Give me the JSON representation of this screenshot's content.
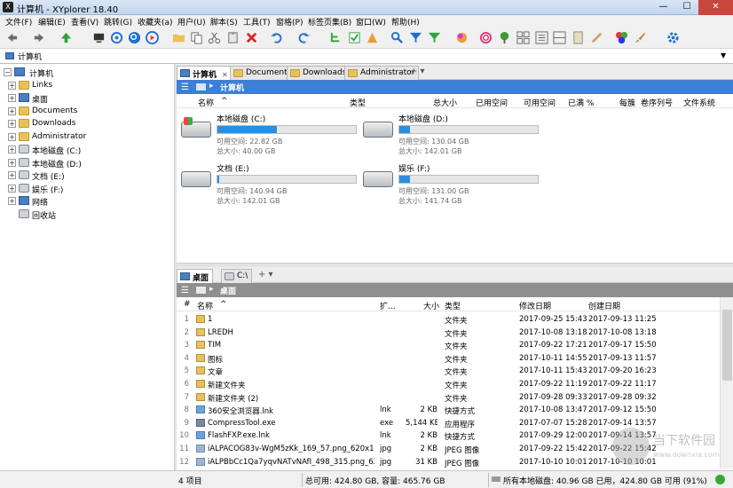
{
  "window": {
    "title": "计算机 - XYplorer 18.40",
    "min": "—",
    "max": "☐",
    "close": "✕",
    "app_icon": "X"
  },
  "menu": [
    "文件(F)",
    "编辑(E)",
    "查看(V)",
    "跳转(G)",
    "收藏夹(a)",
    "用户(U)",
    "脚本(S)",
    "工具(T)",
    "窗格(P)",
    "标签页集(B)",
    "窗口(W)",
    "帮助(H)"
  ],
  "address": {
    "value": "计算机"
  },
  "tree": [
    {
      "label": "计算机",
      "level": 0,
      "icon": "computer-icon",
      "expander": "−"
    },
    {
      "label": "Links",
      "level": 1,
      "icon": "folder-icon",
      "expander": "+"
    },
    {
      "label": "桌面",
      "level": 1,
      "icon": "desktop-icon",
      "expander": "+"
    },
    {
      "label": "Documents",
      "level": 1,
      "icon": "folder-icon",
      "expander": "+"
    },
    {
      "label": "Downloads",
      "level": 1,
      "icon": "folder-icon",
      "expander": "+"
    },
    {
      "label": "Administrator",
      "level": 1,
      "icon": "folder-icon",
      "expander": "+"
    },
    {
      "label": "本地磁盘 (C:)",
      "level": 1,
      "icon": "drive-icon",
      "expander": "+"
    },
    {
      "label": "本地磁盘 (D:)",
      "level": 1,
      "icon": "drive-icon",
      "expander": "+"
    },
    {
      "label": "文档 (E:)",
      "level": 1,
      "icon": "drive-icon",
      "expander": "+"
    },
    {
      "label": "娱乐 (F:)",
      "level": 1,
      "icon": "drive-icon",
      "expander": "+"
    },
    {
      "label": "网络",
      "level": 1,
      "icon": "network-icon",
      "expander": "+"
    },
    {
      "label": "回收站",
      "level": 1,
      "icon": "recycle-bin-icon",
      "expander": ""
    }
  ],
  "top_pane": {
    "tabs": [
      {
        "label": "计算机",
        "active": true,
        "close": "✕"
      },
      {
        "label": "Documents",
        "active": false
      },
      {
        "label": "Downloads",
        "active": false
      },
      {
        "label": "Administrator",
        "active": false
      }
    ],
    "tab_add": "+ ▾",
    "breadcrumb": "计算机",
    "columns": [
      "名称",
      "^",
      "类型",
      "总大小",
      "已用空间",
      "可用空间",
      "已满 %",
      "每簇",
      "卷序列号",
      "文件系统"
    ],
    "drives": [
      {
        "name": "本地磁盘 (C:)",
        "free": "可用空间: 22.82 GB",
        "total": "总大小: 40.00 GB",
        "used_fraction": 0.43,
        "system": true
      },
      {
        "name": "本地磁盘 (D:)",
        "free": "可用空间: 130.04 GB",
        "total": "总大小: 142.01 GB",
        "used_fraction": 0.08,
        "system": false
      },
      {
        "name": "文档 (E:)",
        "free": "可用空间: 140.94 GB",
        "total": "总大小: 142.01 GB",
        "used_fraction": 0.01,
        "system": false
      },
      {
        "name": "娱乐 (F:)",
        "free": "可用空间: 131.00 GB",
        "total": "总大小: 141.74 GB",
        "used_fraction": 0.08,
        "system": false
      }
    ]
  },
  "bottom_pane": {
    "tabs": [
      {
        "label": "桌面",
        "active": true
      },
      {
        "label": "C:\\",
        "active": false
      }
    ],
    "tab_add": "+ ▾",
    "breadcrumb": "桌面",
    "columns": [
      "#",
      "名称",
      "^",
      "扩...",
      "大小",
      "类型",
      "修改日期",
      "创建日期"
    ],
    "files": [
      {
        "n": "1",
        "name": "1",
        "ext": "",
        "size": "",
        "type": "文件夹",
        "modified": "2017-09-25 15:43:42",
        "created": "2017-09-13 11:25:34",
        "icon": "folder-icon"
      },
      {
        "n": "2",
        "name": "LREDH",
        "ext": "",
        "size": "",
        "type": "文件夹",
        "modified": "2017-10-08 13:18:07",
        "created": "2017-10-08 13:18:07",
        "icon": "folder-icon"
      },
      {
        "n": "3",
        "name": "TIM",
        "ext": "",
        "size": "",
        "type": "文件夹",
        "modified": "2017-09-22 17:21:04",
        "created": "2017-09-17 15:50:34",
        "icon": "folder-icon"
      },
      {
        "n": "4",
        "name": "图标",
        "ext": "",
        "size": "",
        "type": "文件夹",
        "modified": "2017-10-11 14:55:20",
        "created": "2017-09-13 11:57:22",
        "icon": "folder-icon"
      },
      {
        "n": "5",
        "name": "文章",
        "ext": "",
        "size": "",
        "type": "文件夹",
        "modified": "2017-10-11 15:43:10",
        "created": "2017-09-20 16:23:02",
        "icon": "folder-icon"
      },
      {
        "n": "6",
        "name": "新建文件夹",
        "ext": "",
        "size": "",
        "type": "文件夹",
        "modified": "2017-09-22 11:19:18",
        "created": "2017-09-22 11:17:16",
        "icon": "folder-icon"
      },
      {
        "n": "7",
        "name": "新建文件夹 (2)",
        "ext": "",
        "size": "",
        "type": "文件夹",
        "modified": "2017-09-28 09:33:34",
        "created": "2017-09-28 09:32:50",
        "icon": "folder-icon"
      },
      {
        "n": "8",
        "name": "360安全浏览器.lnk",
        "ext": "lnk",
        "size": "2 KB",
        "type": "快捷方式",
        "modified": "2017-10-08 13:47:28",
        "created": "2017-09-12 15:50:51",
        "icon": "shortcut-icon"
      },
      {
        "n": "9",
        "name": "CompressTool.exe",
        "ext": "exe",
        "size": "5,144 KB",
        "type": "应用程序",
        "modified": "2017-07-07 15:28:02",
        "created": "2017-09-14 13:57:56",
        "icon": "exe-icon"
      },
      {
        "n": "10",
        "name": "FlashFXP.exe.lnk",
        "ext": "lnk",
        "size": "2 KB",
        "type": "快捷方式",
        "modified": "2017-09-29 12:00:21",
        "created": "2017-09-14 13:57:38",
        "icon": "shortcut-icon"
      },
      {
        "n": "11",
        "name": "iALPACOG83v-WgM5zKk_169_57.png_620x10000...",
        "ext": "jpg",
        "size": "2 KB",
        "type": "JPEG 图像",
        "modified": "2017-09-22 15:42:42",
        "created": "2017-09-22 15:42:42",
        "icon": "image-icon"
      },
      {
        "n": "12",
        "name": "iALPBbCc1Qa7yqvNATvNAfI_498_315.png_620x1...",
        "ext": "jpg",
        "size": "31 KB",
        "type": "JPEG 图像",
        "modified": "2017-10-10 10:01:38",
        "created": "2017-10-10 10:01:38",
        "icon": "image-icon"
      }
    ]
  },
  "status": {
    "items": "4 项目",
    "total": "总可用: 424.80 GB, 容量: 465.76 GB",
    "drive": "所有本地磁盘: 40.96 GB 已用，424.80 GB 可用 (91%)",
    "used_fraction": 0.09
  },
  "watermark": {
    "title": "当下软件园",
    "url": "www.downxia.com"
  },
  "colors": {
    "accent": "#3d7fd6",
    "drive_bar": "#2a8ee0",
    "close": "#c8463e"
  }
}
